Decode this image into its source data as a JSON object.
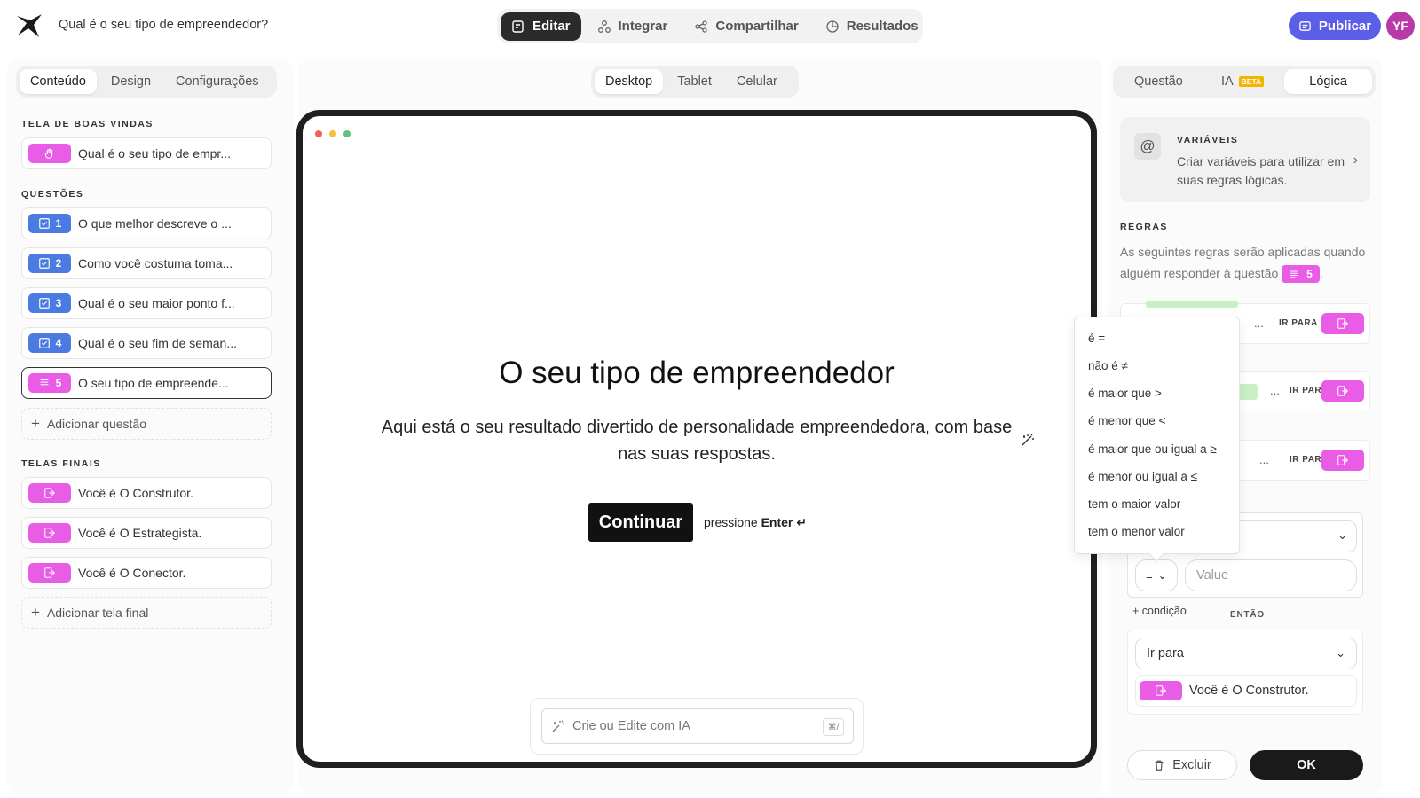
{
  "app": {
    "title": "Qual é o seu tipo de empreendedor?",
    "avatar_initials": "YF",
    "publish_label": "Publicar"
  },
  "nav": [
    {
      "label": "Editar",
      "active": true
    },
    {
      "label": "Integrar",
      "active": false
    },
    {
      "label": "Compartilhar",
      "active": false
    },
    {
      "label": "Resultados",
      "active": false
    }
  ],
  "left": {
    "tabs": [
      {
        "label": "Conteúdo",
        "active": true
      },
      {
        "label": "Design",
        "active": false
      },
      {
        "label": "Configurações",
        "active": false
      }
    ],
    "welcome": {
      "heading": "TELA DE BOAS VINDAS",
      "item": "Qual é o seu tipo de empr..."
    },
    "questions": {
      "heading": "QUESTÕES",
      "items": [
        {
          "number": "1",
          "label": "O que melhor descreve o ..."
        },
        {
          "number": "2",
          "label": "Como você costuma toma..."
        },
        {
          "number": "3",
          "label": "Qual é o seu maior ponto f..."
        },
        {
          "number": "4",
          "label": "Qual é o seu fim de seman..."
        },
        {
          "number": "5",
          "label": "O seu tipo de empreende..."
        }
      ],
      "add_label": "Adicionar questão"
    },
    "endings": {
      "heading": "TELAS FINAIS",
      "items": [
        "Você é O Construtor.",
        "Você é O Estrategista.",
        "Você é O Conector."
      ],
      "add_label": "Adicionar tela final"
    }
  },
  "preview": {
    "devices": [
      {
        "label": "Desktop",
        "active": true
      },
      {
        "label": "Tablet",
        "active": false
      },
      {
        "label": "Celular",
        "active": false
      }
    ],
    "title": "O seu tipo de empreendedor",
    "description": "Aqui está o seu resultado divertido de personalidade empreendedora, com base nas suas respostas.",
    "cta": "Continuar",
    "hint_prefix": "pressione",
    "hint_key": "Enter ↵",
    "ai_placeholder": "Crie ou Edite com IA",
    "ai_shortcut": "⌘/"
  },
  "right": {
    "tabs": [
      {
        "label": "Questão",
        "active": false
      },
      {
        "label": "IA",
        "active": false,
        "badge": "BETA"
      },
      {
        "label": "Lógica",
        "active": true
      }
    ],
    "variables": {
      "heading": "VARIÁVEIS",
      "text": "Criar variáveis para utilizar em suas regras lógicas."
    },
    "rules": {
      "heading": "REGRAS",
      "text_before": "As seguintes regras serão aplicadas quando alguém responder à questão",
      "question_number": "5",
      "text_after": ".",
      "ellipsis": "...",
      "goto_label": "IR PARA"
    },
    "condition": {
      "operator": "=",
      "value_placeholder": "Value",
      "add_condition": "+ condição",
      "then_label": "ENTÃO"
    },
    "action": {
      "select": "Ir para",
      "target": "Você é O Construtor."
    },
    "buttons": {
      "delete": "Excluir",
      "ok": "OK"
    }
  },
  "operator_dropdown": [
    "é  =",
    "não é  ≠",
    "é maior que  >",
    "é menor que  <",
    "é maior que ou igual a  ≥",
    "é menor ou igual a  ≤",
    "tem o maior valor",
    "tem o menor valor"
  ],
  "colors": {
    "accent": "#5b5fe8",
    "pink_badge": "#e85ce6",
    "blue_badge": "#4b7be0",
    "avatar": "#b83aa8"
  }
}
